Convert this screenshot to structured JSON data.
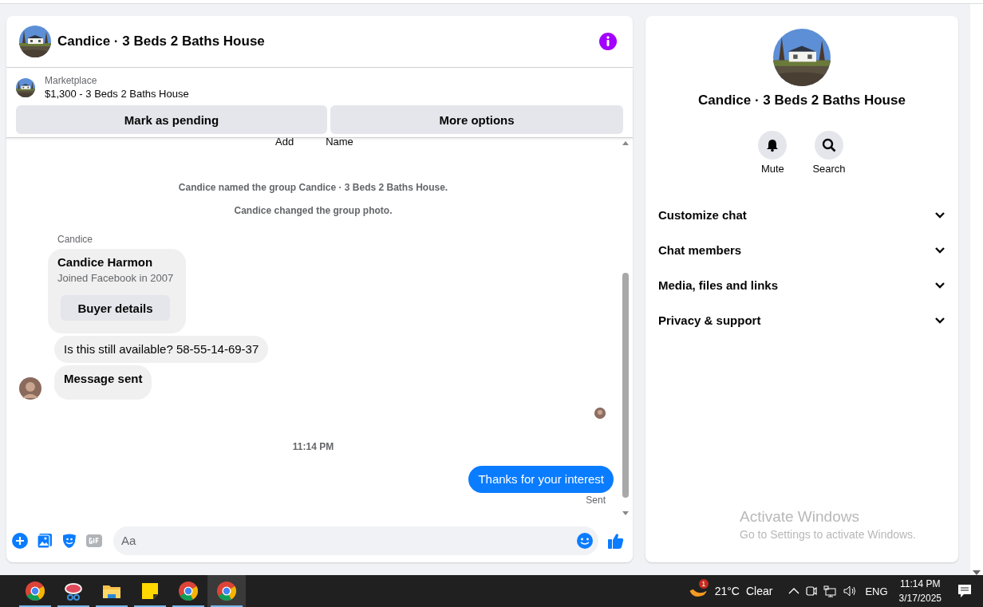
{
  "conversation": {
    "title": "Candice · 3 Beds 2 Baths House"
  },
  "listing": {
    "source": "Marketplace",
    "title": "$1,300 - 3 Beds 2 Baths House",
    "buttons": [
      "Mark as pending",
      "More options"
    ]
  },
  "thread": [
    {
      "kind": "actions",
      "labels": [
        "Add",
        "Name"
      ]
    },
    {
      "kind": "system",
      "text": "Candice named the group Candice · 3 Beds 2 Baths House."
    },
    {
      "kind": "system",
      "text": "Candice changed the group photo."
    },
    {
      "kind": "sender",
      "text": "Candice"
    },
    {
      "kind": "card",
      "name": "Candice Harmon",
      "subtitle": "Joined Facebook in 2007",
      "button": "Buyer details"
    },
    {
      "kind": "incoming",
      "text": "Is this still available? 58-55-14-69-37",
      "avatar": false,
      "bold": false
    },
    {
      "kind": "incoming",
      "text": "Message sent",
      "avatar": true,
      "bold": true
    },
    {
      "kind": "seen"
    },
    {
      "kind": "time",
      "text": "11:14 PM"
    },
    {
      "kind": "outgoing",
      "text": "Thanks for your interest"
    },
    {
      "kind": "status",
      "text": "Sent"
    }
  ],
  "composer": {
    "placeholder": "Aa"
  },
  "details": {
    "title": "Candice · 3 Beds 2 Baths House",
    "actions": [
      {
        "label": "Mute"
      },
      {
        "label": "Search"
      }
    ],
    "sections": [
      {
        "label": "Customize chat",
        "expanded": false
      },
      {
        "label": "Chat members",
        "expanded": false
      },
      {
        "label": "Media, files and links",
        "expanded": false
      },
      {
        "label": "Privacy & support",
        "expanded": false
      }
    ]
  },
  "activation": {
    "title": "Activate Windows",
    "subtitle": "Go to Settings to activate Windows."
  },
  "taskbar": {
    "apps": [
      {
        "kind": "chrome",
        "running": true,
        "selected": false
      },
      {
        "kind": "snip",
        "running": true,
        "selected": false
      },
      {
        "kind": "folder",
        "running": true,
        "selected": false
      },
      {
        "kind": "notes",
        "running": true,
        "selected": false
      },
      {
        "kind": "chrome",
        "running": true,
        "selected": false
      },
      {
        "kind": "chrome",
        "running": true,
        "selected": true
      }
    ],
    "weather": {
      "badge": "1",
      "temperature": "21°C",
      "condition": "Clear"
    },
    "language": "ENG",
    "time": "11:14 PM",
    "date": "3/17/2025"
  }
}
